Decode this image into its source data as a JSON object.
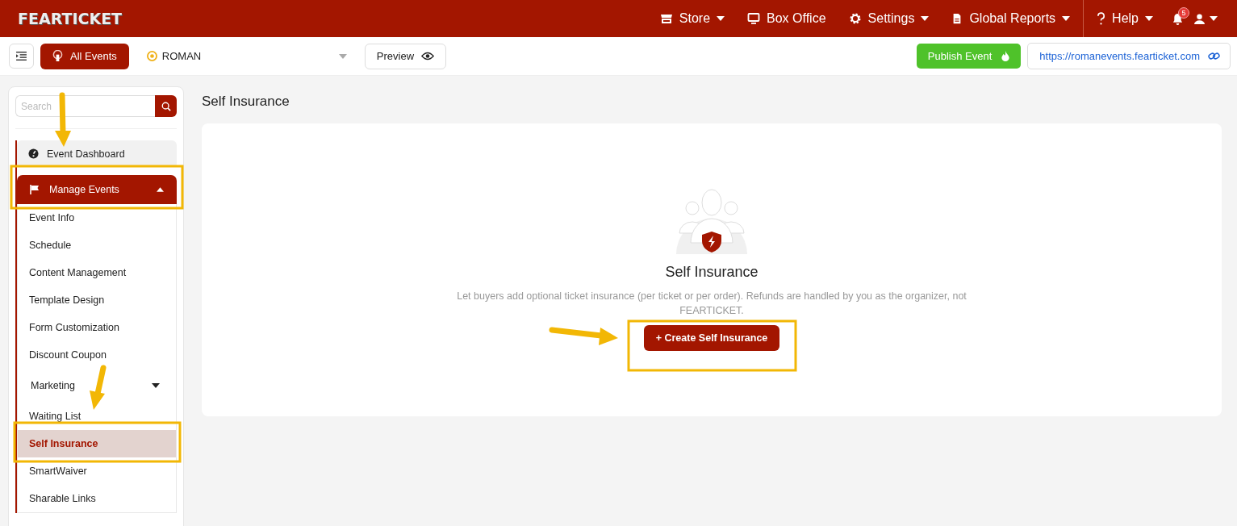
{
  "header": {
    "logo": "FEARTICKET",
    "nav": [
      {
        "label": "Store",
        "dropdown": true
      },
      {
        "label": "Box Office",
        "dropdown": false
      },
      {
        "label": "Settings",
        "dropdown": true
      },
      {
        "label": "Global Reports",
        "dropdown": true
      }
    ],
    "help": {
      "label": "Help",
      "dropdown": true
    },
    "notifications": {
      "badge": "5"
    },
    "user": {
      "dropdown": true
    }
  },
  "toolbar": {
    "all_events": "All Events",
    "event": "ROMAN",
    "preview": "Preview",
    "publish": "Publish Event",
    "url": "https://romanevents.fearticket.com"
  },
  "sidebar": {
    "search": {
      "placeholder": "Search"
    },
    "items": [
      {
        "label": "Event Dashboard",
        "kind": "top",
        "selected": false
      },
      {
        "label": "Manage Events",
        "kind": "group",
        "expanded": true,
        "children": [
          {
            "label": "Event Info",
            "kind": "link",
            "selected": false
          },
          {
            "label": "Schedule",
            "kind": "link",
            "selected": false
          },
          {
            "label": "Content Management",
            "kind": "link",
            "selected": false
          },
          {
            "label": "Template Design",
            "kind": "link",
            "selected": false
          },
          {
            "label": "Form Customization",
            "kind": "link",
            "selected": false
          },
          {
            "label": "Discount Coupon",
            "kind": "link",
            "selected": false
          },
          {
            "label": "Marketing",
            "kind": "submenu",
            "expanded": false
          },
          {
            "label": "Waiting List",
            "kind": "link",
            "selected": false
          },
          {
            "label": "Self Insurance",
            "kind": "link",
            "selected": true
          },
          {
            "label": "SmartWaiver",
            "kind": "link",
            "selected": false
          },
          {
            "label": "Sharable Links",
            "kind": "link",
            "selected": false
          }
        ]
      }
    ]
  },
  "main": {
    "title": "Self Insurance",
    "empty_state": {
      "heading": "Self Insurance",
      "text": "Let buyers add optional ticket insurance (per ticket or per order). Refunds are handled by you as the organizer, not FEARTICKET.",
      "button": "+ Create Self Insurance"
    }
  }
}
